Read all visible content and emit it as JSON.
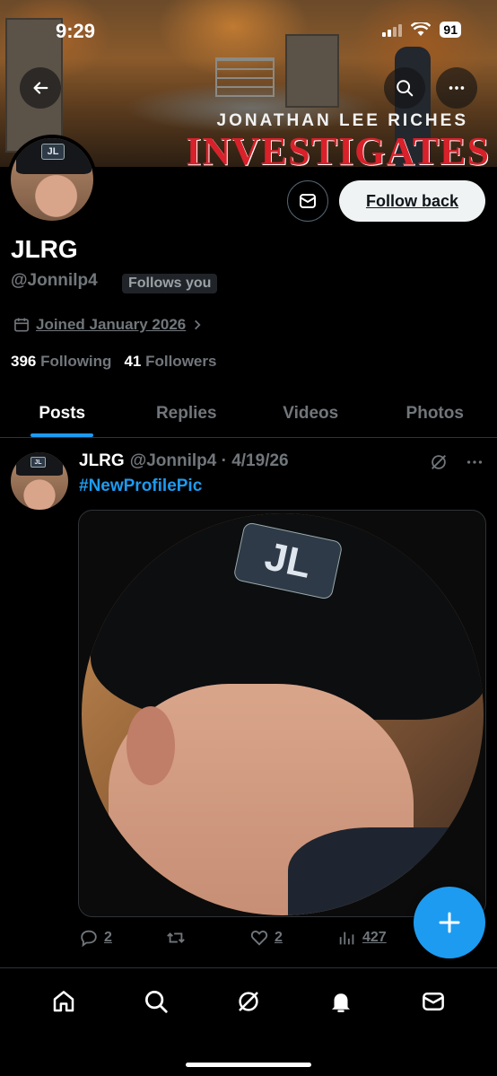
{
  "status_bar": {
    "time": "9:29",
    "battery": "91"
  },
  "banner": {
    "subtitle": "JONATHAN LEE RICHES",
    "title": "INVESTIGATES"
  },
  "profile": {
    "display_name": "JLRG",
    "handle": "@Jonnilp4",
    "follows_you": "Follows you",
    "joined": "Joined January 2026",
    "following_count": "396",
    "following_label": "Following",
    "followers_count": "41",
    "followers_label": "Followers",
    "follow_back_label": "Follow back"
  },
  "tabs": [
    {
      "label": "Posts",
      "active": true
    },
    {
      "label": "Replies"
    },
    {
      "label": "Videos"
    },
    {
      "label": "Photos"
    }
  ],
  "post": {
    "author": "JLRG",
    "meta": "@Jonnilp4 · 4/19/26",
    "text": "#NewProfilePic",
    "cap_logo": "JL",
    "replies": "2",
    "likes": "2",
    "views": "427"
  },
  "colors": {
    "accent": "#1d9bf0",
    "background": "#000000",
    "banner_red": "#d8212a"
  },
  "icons": [
    "back-arrow-icon",
    "search-icon",
    "more-icon",
    "mail-icon",
    "calendar-icon",
    "chevron-right-icon",
    "grok-icon",
    "reply-icon",
    "retweet-icon",
    "like-icon",
    "views-icon",
    "plus-icon",
    "home-icon",
    "notifications-icon"
  ]
}
